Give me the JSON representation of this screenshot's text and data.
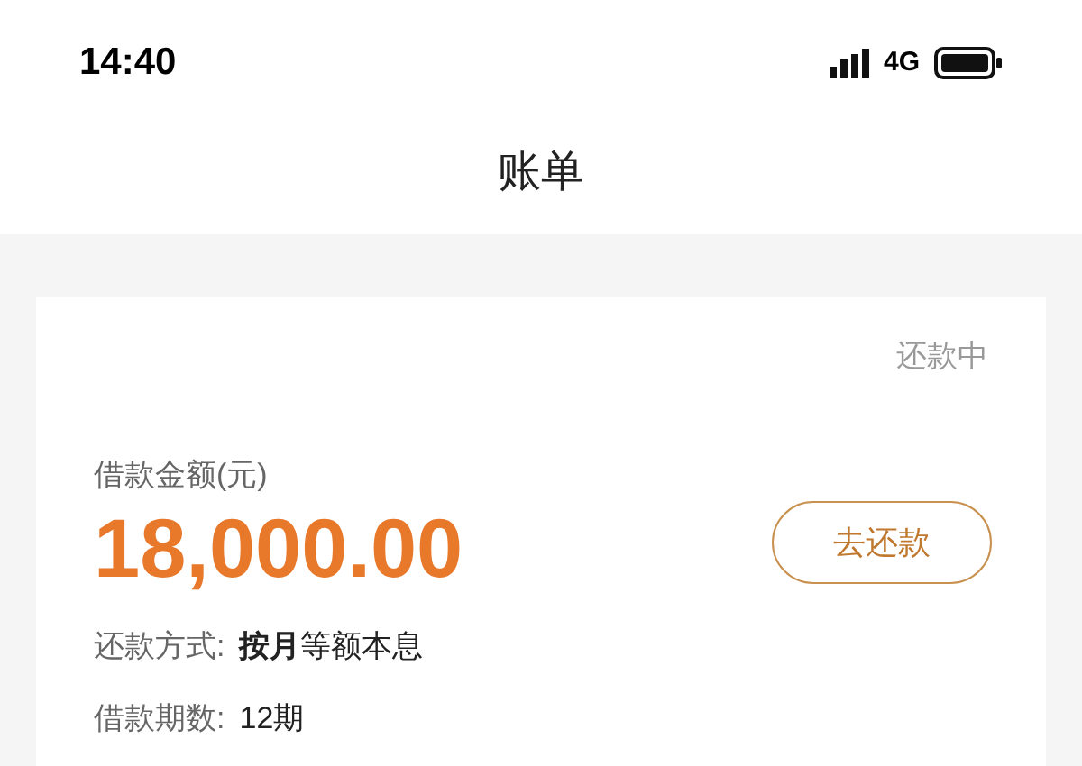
{
  "status_bar": {
    "time": "14:40",
    "network": "4G"
  },
  "header": {
    "title": "账单"
  },
  "bill": {
    "status": "还款中",
    "amount_label": "借款金额(元)",
    "amount": "18,000.00",
    "action": "去还款",
    "details": [
      {
        "label": "还款方式:",
        "value": "**按月**等额本息"
      },
      {
        "label": "借款期数:",
        "value": "12期"
      }
    ]
  }
}
